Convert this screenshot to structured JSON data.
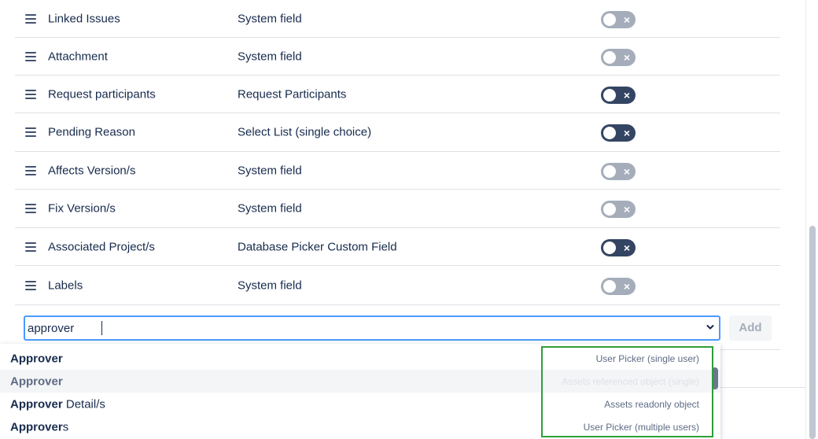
{
  "fields": [
    {
      "name": "Linked Issues",
      "type": "System field",
      "toggle": "off"
    },
    {
      "name": "Attachment",
      "type": "System field",
      "toggle": "off"
    },
    {
      "name": "Request participants",
      "type": "Request Participants",
      "toggle": "on"
    },
    {
      "name": "Pending Reason",
      "type": "Select List (single choice)",
      "toggle": "on"
    },
    {
      "name": "Affects Version/s",
      "type": "System field",
      "toggle": "off"
    },
    {
      "name": "Fix Version/s",
      "type": "System field",
      "toggle": "off"
    },
    {
      "name": "Associated Project/s",
      "type": "Database Picker Custom Field",
      "toggle": "on"
    },
    {
      "name": "Labels",
      "type": "System field",
      "toggle": "off"
    }
  ],
  "toggle_symbol": "×",
  "add_field": {
    "value": "approver",
    "add_label": "Add"
  },
  "dropdown": {
    "options": [
      {
        "match": "Approver",
        "rest": "",
        "type": "User Picker (single user)",
        "highlighted": false
      },
      {
        "match": "Approver",
        "rest": "",
        "type": "Assets referenced object (single)",
        "highlighted": true
      },
      {
        "match": "Approver",
        "rest": " Detail/s",
        "type": "Assets readonly object",
        "highlighted": false
      },
      {
        "match": "Approver",
        "rest": "s",
        "type": "User Picker (multiple users)",
        "highlighted": false
      }
    ]
  },
  "colors": {
    "toggle_on": "#344563",
    "toggle_off": "#a5adba",
    "focus": "#4c9aff",
    "annotation_box": "#2e9e3a"
  }
}
